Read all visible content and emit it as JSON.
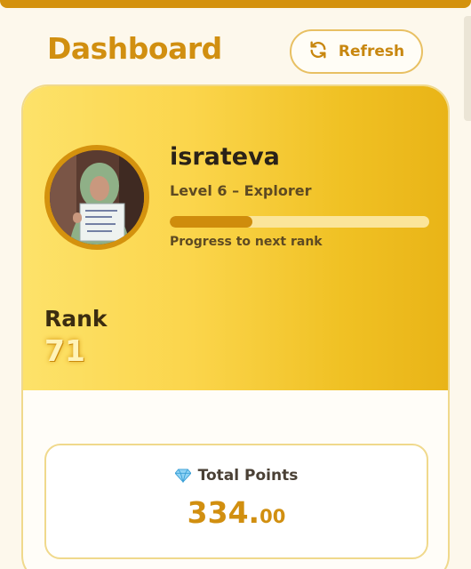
{
  "header": {
    "title": "Dashboard",
    "refresh_label": "Refresh"
  },
  "icons": {
    "refresh": "refresh-icon",
    "gem": "gem-icon"
  },
  "profile": {
    "username": "israteva",
    "level_text": "Level 6 – Explorer",
    "progress_fraction": 0.32,
    "progress_label": "Progress to next rank",
    "rank_label": "Rank",
    "rank_value": "71"
  },
  "points": {
    "label": "Total Points",
    "value_int": "334.",
    "value_dec": "00"
  },
  "colors": {
    "accent": "#d4920e",
    "hero_gradient_start": "#fde26a",
    "hero_gradient_end": "#e9b417",
    "background": "#fdf8ec"
  }
}
